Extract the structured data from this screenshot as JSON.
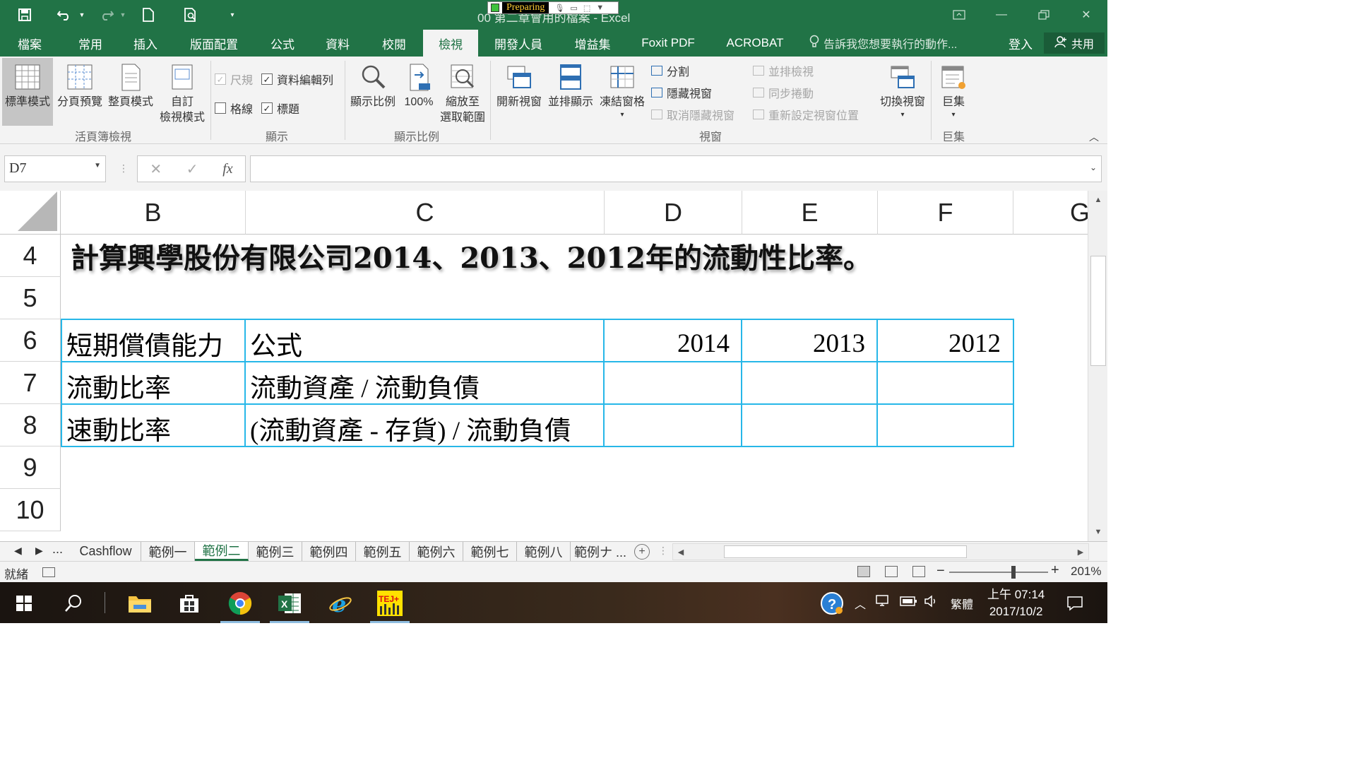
{
  "window": {
    "title": "00 第二章會用的檔案 - Excel",
    "recorder_label": "Preparing",
    "colors": {
      "excel_green": "#217346",
      "table_border": "#27b7e8"
    }
  },
  "quick_access": {
    "icons": [
      "save-icon",
      "undo-icon",
      "redo-icon",
      "new-file-icon",
      "print-preview-icon",
      "customize-icon"
    ]
  },
  "ribbon": {
    "tabs": [
      "檔案",
      "常用",
      "插入",
      "版面配置",
      "公式",
      "資料",
      "校閱",
      "檢視",
      "開發人員",
      "增益集",
      "Foxit PDF",
      "ACROBAT"
    ],
    "active_tab": "檢視",
    "tell_me": "告訴我您想要執行的動作...",
    "sign_in": "登入",
    "share": "共用",
    "groups": {
      "workbook_views": {
        "label": "活頁簿檢視",
        "normal": "標準模式",
        "page_break": "分頁預覽",
        "page_layout": "整頁模式",
        "custom_1": "自訂",
        "custom_2": "檢視模式"
      },
      "show": {
        "label": "顯示",
        "ruler": "尺規",
        "formula_bar": "資料編輯列",
        "gridlines": "格線",
        "headings": "標題"
      },
      "zoom": {
        "label": "顯示比例",
        "zoom": "顯示比例",
        "hundred": "100%",
        "selection_1": "縮放至",
        "selection_2": "選取範圍"
      },
      "window": {
        "label": "視窗",
        "new_window": "開新視窗",
        "arrange_all": "並排顯示",
        "freeze": "凍結窗格",
        "split": "分割",
        "hide": "隱藏視窗",
        "unhide": "取消隱藏視窗",
        "side_by_side": "並排檢視",
        "sync_scroll": "同步捲動",
        "reset_position": "重新設定視窗位置",
        "switch": "切換視窗"
      },
      "macros": {
        "label": "巨集",
        "macros": "巨集"
      }
    }
  },
  "formula_bar": {
    "name_box": "D7",
    "fx": "fx",
    "formula": ""
  },
  "sheet": {
    "columns": [
      "B",
      "C",
      "D",
      "E",
      "F",
      "G"
    ],
    "rows": [
      "4",
      "5",
      "6",
      "7",
      "8",
      "9",
      "10"
    ],
    "title": "計算興學股份有限公司2014、2013、2012年的流動性比率。",
    "table": {
      "header": [
        "短期償債能力",
        "公式",
        "2014",
        "2013",
        "2012"
      ],
      "rows": [
        [
          "流動比率",
          "流動資產 / 流動負債",
          "",
          "",
          ""
        ],
        [
          "速動比率",
          "(流動資產 - 存貨) / 流動負債",
          "",
          "",
          ""
        ]
      ]
    }
  },
  "sheet_tabs": {
    "more_left": "...",
    "tabs": [
      "Cashflow",
      "範例一",
      "範例二",
      "範例三",
      "範例四",
      "範例五",
      "範例六",
      "範例七",
      "範例八",
      "範例ナ ..."
    ],
    "active": "範例二"
  },
  "status_bar": {
    "status": "就緒",
    "zoom": "201%"
  },
  "taskbar": {
    "ime": "繁體",
    "time": "上午 07:14",
    "date": "2017/10/2"
  }
}
